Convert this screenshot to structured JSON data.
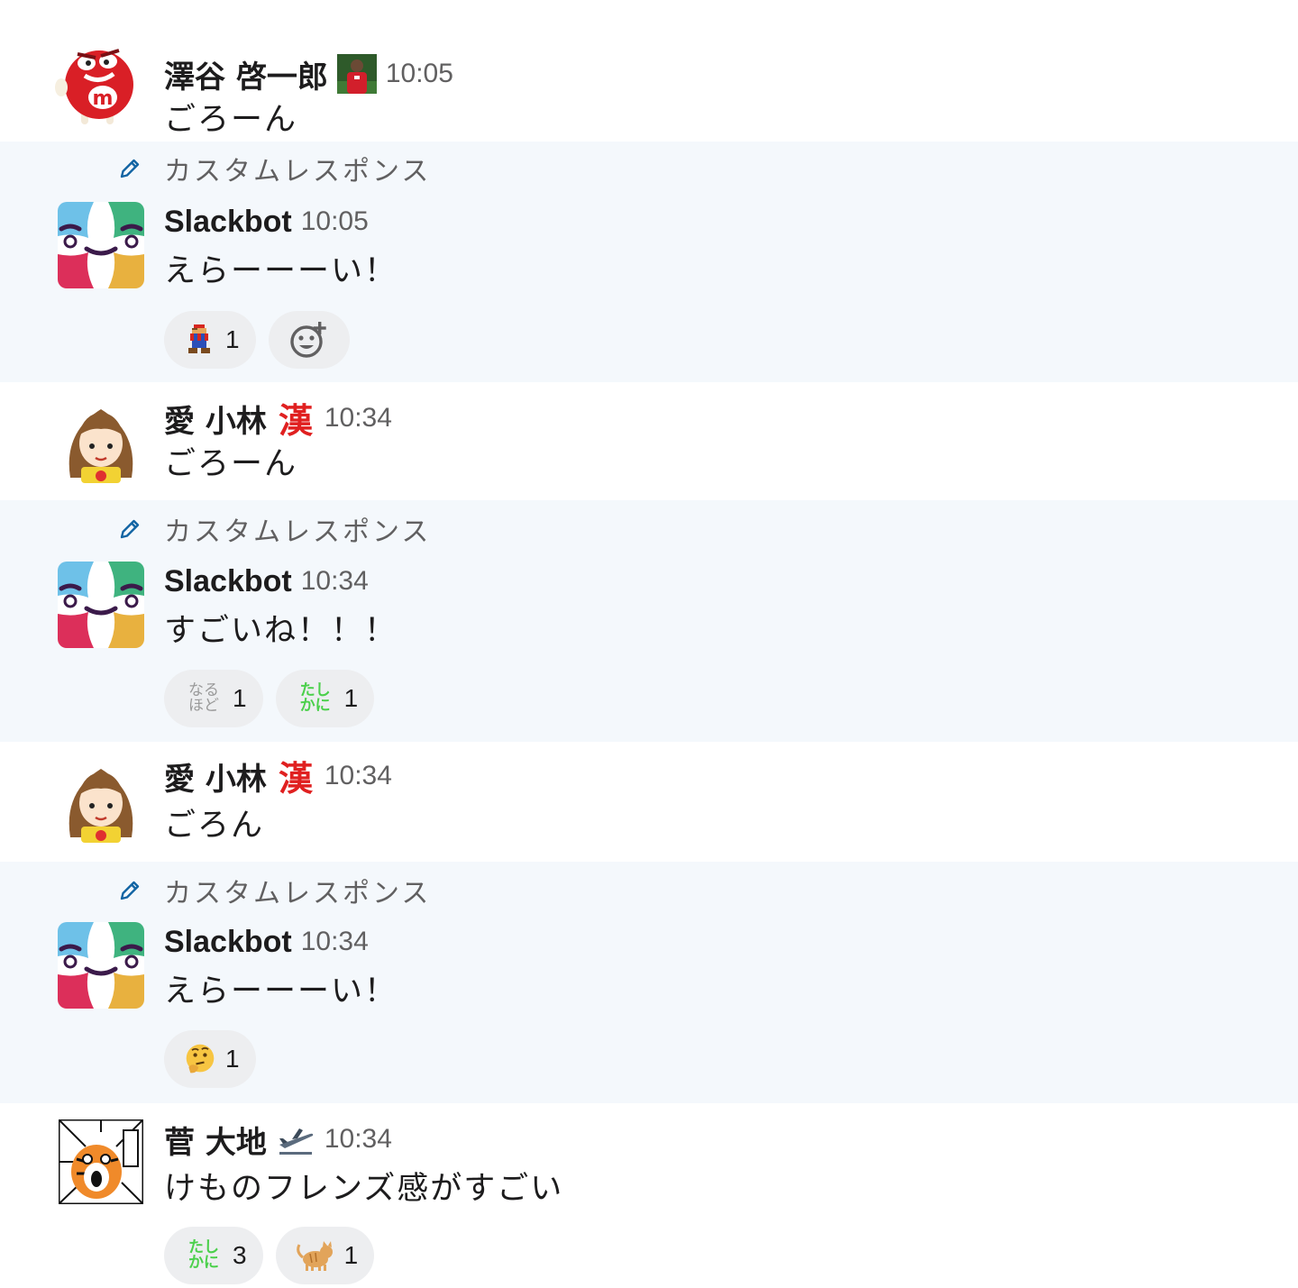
{
  "partial_top_text": "ごろーん",
  "messages": [
    {
      "user": "澤谷 啓一郎",
      "status_emoji": "soccer-player-emoji",
      "time": "10:05",
      "text": "ごろーん",
      "avatar": "mms-red-avatar"
    },
    {
      "custom_label": "カスタムレスポンス",
      "user": "Slackbot",
      "time": "10:05",
      "text": "えらーーーい！",
      "avatar": "slackbot-avatar",
      "reactions": [
        {
          "emoji": "mario-emoji",
          "count": "1"
        }
      ],
      "add_reaction_icon": "add-reaction-icon"
    },
    {
      "user": "愛 小林",
      "status_emoji": "kanji-emoji",
      "time": "10:34",
      "text": "ごろーん",
      "avatar": "girl-avatar"
    },
    {
      "custom_label": "カスタムレスポンス",
      "user": "Slackbot",
      "time": "10:34",
      "text": "すごいね！！！",
      "avatar": "slackbot-avatar",
      "reactions": [
        {
          "emoji": "naruhodo-emoji",
          "emoji_text": "なる\nほど",
          "count": "1"
        },
        {
          "emoji": "tashikani-emoji",
          "emoji_text": "たし\nかに",
          "count": "1"
        }
      ]
    },
    {
      "user": "愛 小林",
      "status_emoji": "kanji-emoji",
      "time": "10:34",
      "text": "ごろん",
      "avatar": "girl-avatar"
    },
    {
      "custom_label": "カスタムレスポンス",
      "user": "Slackbot",
      "time": "10:34",
      "text": "えらーーーい！",
      "avatar": "slackbot-avatar",
      "reactions": [
        {
          "emoji": "thinking-face-emoji",
          "count": "1"
        }
      ]
    },
    {
      "user": "菅 大地",
      "status_emoji": "airplane-departure-emoji",
      "time": "10:34",
      "text": "けものフレンズ感がすごい",
      "avatar": "tiger-manga-avatar",
      "reactions": [
        {
          "emoji": "tashikani-emoji",
          "emoji_text": "たし\nかに",
          "count": "3"
        },
        {
          "emoji": "cat-emoji",
          "count": "1"
        }
      ]
    }
  ],
  "colors": {
    "highlight_bg": "#f4f8fc",
    "reaction_bg": "#edeef0",
    "timestamp": "#616061",
    "pen": "#1264a3"
  }
}
